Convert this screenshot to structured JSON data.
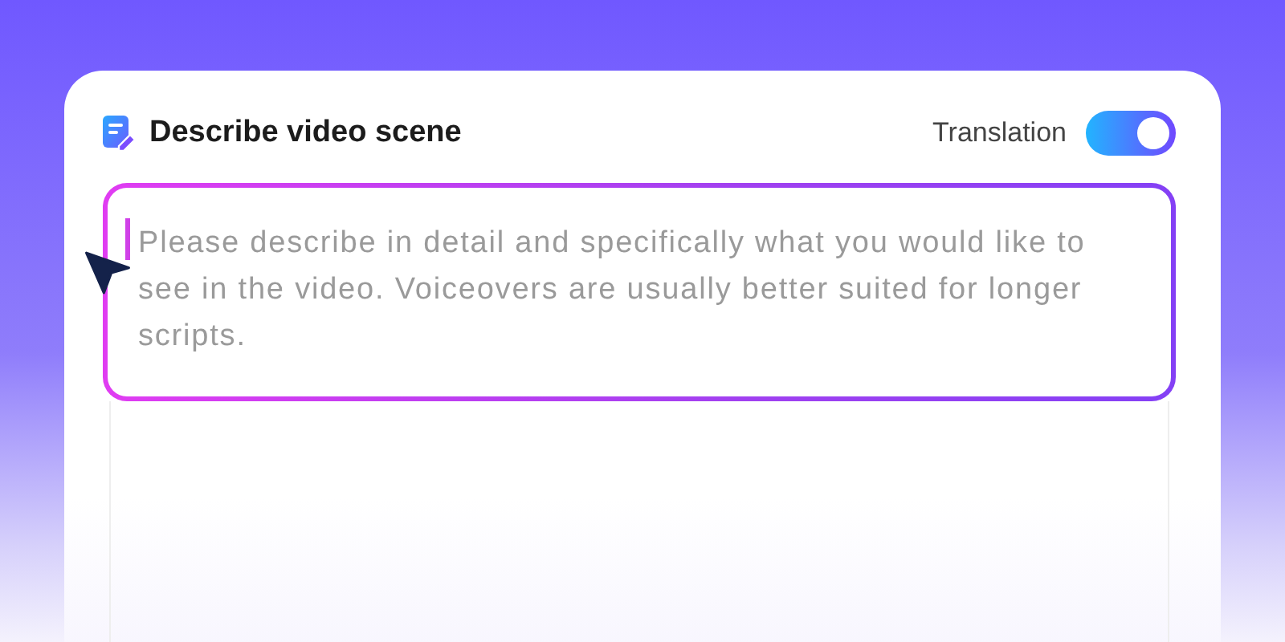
{
  "header": {
    "title": "Describe video scene"
  },
  "translation": {
    "label": "Translation",
    "on": true
  },
  "scene_field": {
    "placeholder": "Please describe in detail and specifically what you would like to see in the video. Voiceovers are usually better suited for longer scripts."
  }
}
